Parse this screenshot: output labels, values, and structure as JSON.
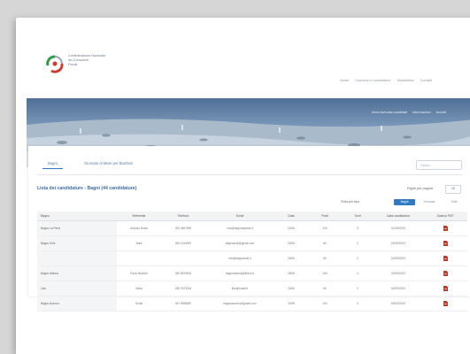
{
  "header": {
    "logo_lines": [
      "Confederazione Nazionale",
      "dei Consulenti",
      "Fiscali"
    ],
    "nav_links": [
      "Home",
      "Concorso e candidature",
      "Modulistica",
      "Contatti"
    ]
  },
  "hero": {
    "links": [
      "Area riservata candidati",
      "Informazioni",
      "Accedi"
    ]
  },
  "tabs": [
    "Bagni",
    "Giornate di Mare per Bambini"
  ],
  "search": {
    "placeholder": "Cerca..."
  },
  "list": {
    "title": "Lista dei candidature - Bagni (44 candidature)",
    "per_page_label": "Righe per pagina",
    "per_page_value": "10",
    "filter_label": "Filtra per tipo",
    "filters": [
      "Bagni",
      "Giornate",
      "Tutte"
    ]
  },
  "table": {
    "columns": [
      "Bagno",
      "Referente",
      "Telefono",
      "Email",
      "Data",
      "Posti",
      "Turni",
      "Data candidatura",
      "Scarica PDF"
    ],
    "rows": [
      [
        "Bagno La Perla",
        "Antonio Rossi",
        "333 4567890",
        "info@bagnolaperla.it",
        "12/06",
        "120",
        "3",
        "01/05/2023",
        ""
      ],
      [
        "Bagno Sole",
        "Sara",
        "349 1234567",
        "bagnosole@gmail.com",
        "15/06",
        "80",
        "2",
        "02/05/2023",
        ""
      ],
      [
        "",
        "",
        "",
        "info@bagnosole.it",
        "15/06",
        "80",
        "2",
        "02/05/2023",
        ""
      ],
      [
        "Bagno Marina",
        "Paolo Bianchi",
        "340 9876543",
        "bagnomarina@libero.it",
        "18/06",
        "150",
        "4",
        "03/05/2023",
        ""
      ],
      [
        "Lido",
        "Mara",
        "338 2223334",
        "lido@email.it",
        "20/06",
        "60",
        "2",
        "04/05/2023",
        ""
      ],
      [
        "Bagno Azzurro",
        "Giulia",
        "347 5558887",
        "bagnoazzurro@gmail.com",
        "22/06",
        "100",
        "3",
        "05/05/2023",
        ""
      ]
    ]
  },
  "colors": {
    "accent": "#2f7ac0",
    "title": "#3b6ea5",
    "pdf": "#c0392b"
  }
}
